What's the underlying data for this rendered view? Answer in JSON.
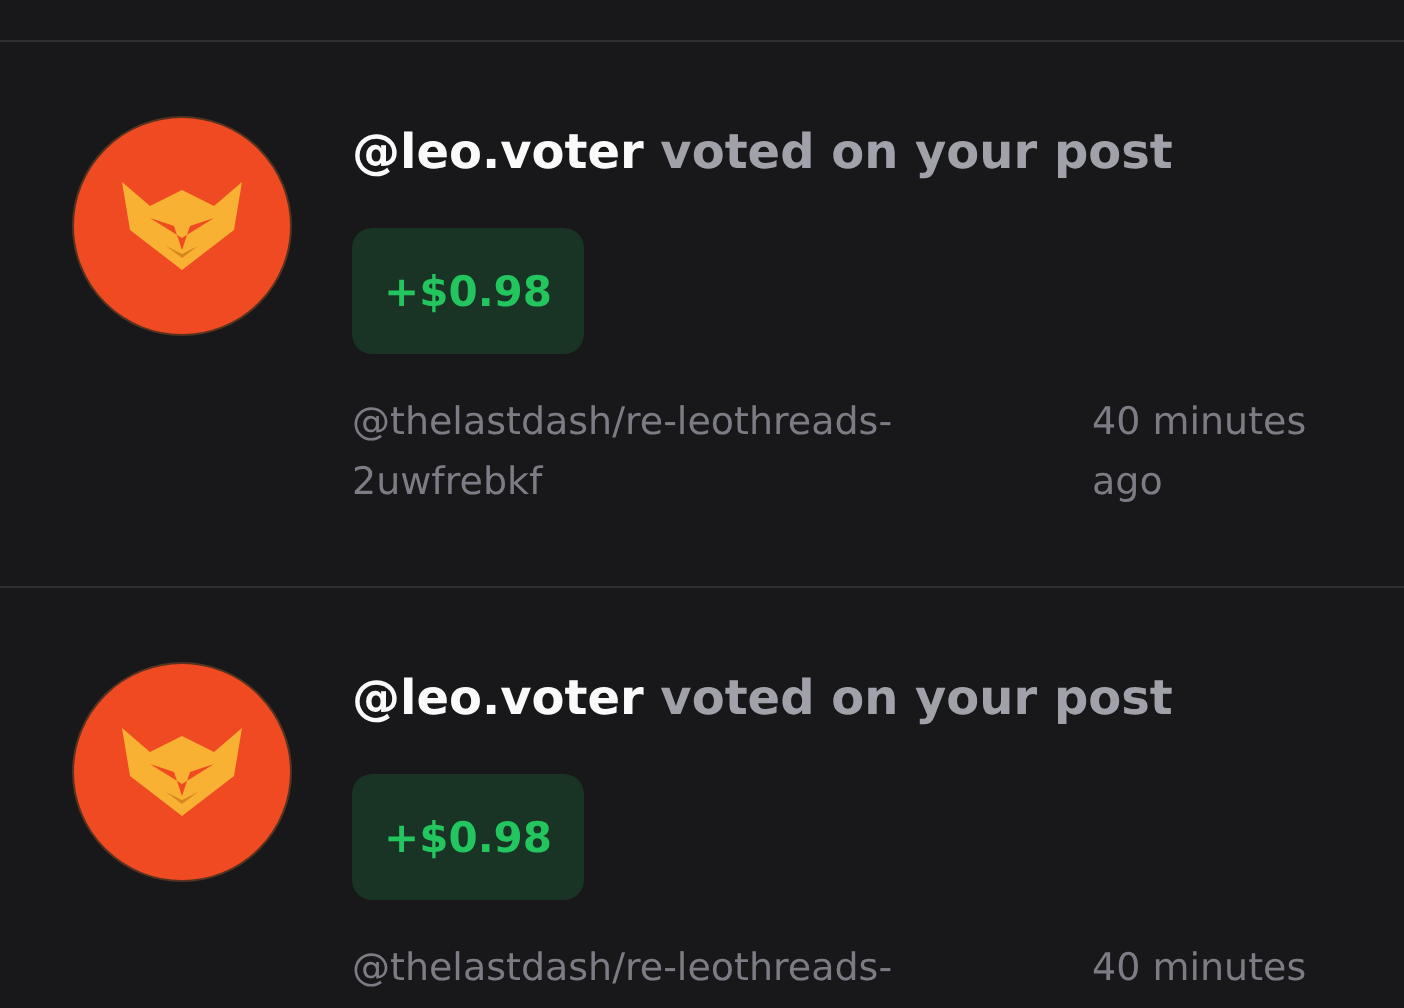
{
  "notifications": [
    {
      "message": "**@leo.voter** voted on your post",
      "amount": "+$0.98",
      "permlink": "@thelastdash/re-leothreads-2uwfrebkf",
      "time": "40 minutes ago"
    },
    {
      "message": "**@leo.voter** voted on your post",
      "amount": "+$0.98",
      "permlink": "@thelastdash/re-leothreads-",
      "time": "40 minutes"
    }
  ]
}
